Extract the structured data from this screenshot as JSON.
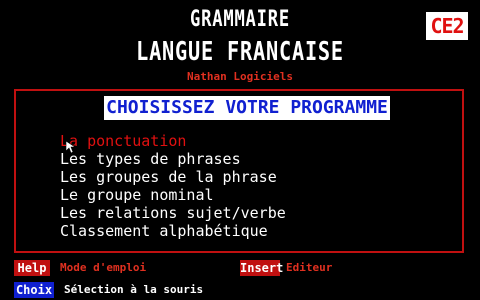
{
  "header": {
    "title_line1": "GRAMMAIRE",
    "title_line2": "LANGUE FRANCAISE",
    "publisher": "Nathan Logiciels",
    "level_badge": "CE2"
  },
  "panel": {
    "heading": "CHOISISSEZ VOTRE PROGRAMME",
    "items": [
      {
        "label": "La ponctuation",
        "selected": true
      },
      {
        "label": "Les types de phrases",
        "selected": false
      },
      {
        "label": "Les groupes de la phrase",
        "selected": false
      },
      {
        "label": "Le groupe nominal",
        "selected": false
      },
      {
        "label": "Les relations sujet/verbe",
        "selected": false
      },
      {
        "label": "Classement alphabétique",
        "selected": false
      }
    ]
  },
  "footer": {
    "help_key": "Help",
    "help_label": "Mode d'emploi",
    "insert_key": "Insert",
    "insert_label": "Editeur",
    "choice_key": "Choix",
    "choice_label": "Sélection à la souris"
  },
  "colors": {
    "background": "#000000",
    "accent_red": "#c01010",
    "accent_blue": "#1020d0",
    "text_white": "#ffffff"
  },
  "icons": {
    "cursor": "mouse-pointer-icon"
  }
}
